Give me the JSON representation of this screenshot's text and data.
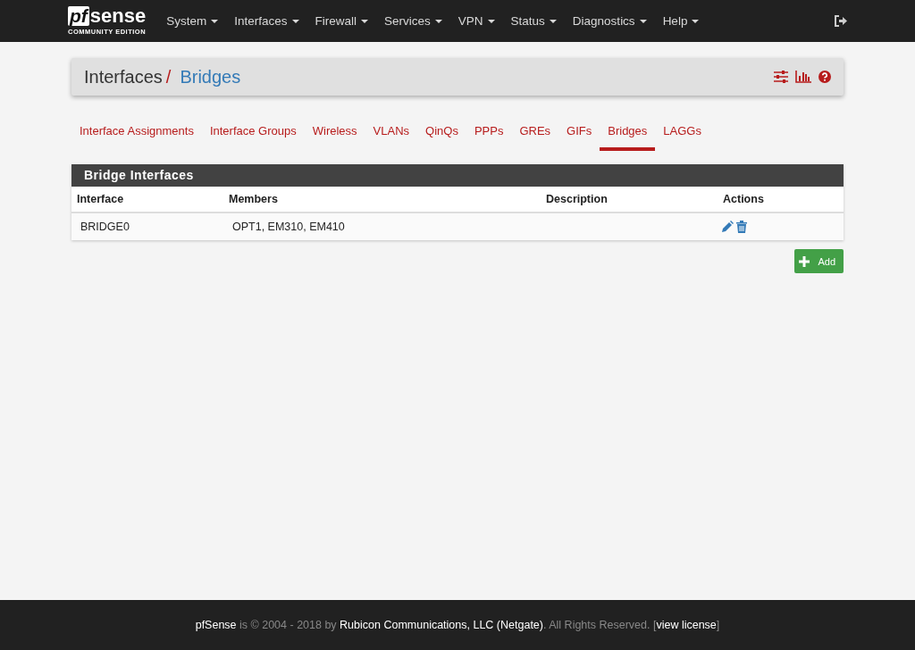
{
  "navbar": {
    "logo": {
      "mark": "pf",
      "name": "sense",
      "edition": "COMMUNITY EDITION"
    },
    "menus": [
      {
        "label": "System"
      },
      {
        "label": "Interfaces"
      },
      {
        "label": "Firewall"
      },
      {
        "label": "Services"
      },
      {
        "label": "VPN"
      },
      {
        "label": "Status"
      },
      {
        "label": "Diagnostics"
      },
      {
        "label": "Help"
      }
    ]
  },
  "breadcrumb": {
    "parent": "Interfaces",
    "separator": "/",
    "current": "Bridges"
  },
  "tabs": [
    {
      "label": "Interface Assignments",
      "selected": false
    },
    {
      "label": "Interface Groups",
      "selected": false
    },
    {
      "label": "Wireless",
      "selected": false
    },
    {
      "label": "VLANs",
      "selected": false
    },
    {
      "label": "QinQs",
      "selected": false
    },
    {
      "label": "PPPs",
      "selected": false
    },
    {
      "label": "GREs",
      "selected": false
    },
    {
      "label": "GIFs",
      "selected": false
    },
    {
      "label": "Bridges",
      "selected": true
    },
    {
      "label": "LAGGs",
      "selected": false
    }
  ],
  "panel": {
    "title": "Bridge Interfaces",
    "columns": [
      "Interface",
      "Members",
      "Description",
      "Actions"
    ],
    "rows": [
      {
        "interface": "BRIDGE0",
        "members": "OPT1, EM310, EM410"
      }
    ]
  },
  "add_button": {
    "label": "Add"
  },
  "footer": [
    {
      "kind": "link",
      "text": "pfSense"
    },
    {
      "kind": "text",
      "text": " is © 2004 - 2018 by "
    },
    {
      "kind": "link",
      "text": "Rubicon Communications, LLC (Netgate)"
    },
    {
      "kind": "text",
      "text": ". All Rights Reserved. ["
    },
    {
      "kind": "link",
      "text": "view license"
    },
    {
      "kind": "text",
      "text": "]"
    }
  ]
}
